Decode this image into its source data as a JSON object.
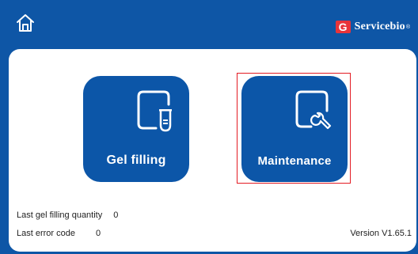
{
  "header": {
    "home_icon": "home-icon",
    "brand": {
      "mark": "G",
      "name": "Servicebio",
      "reg": "®",
      "mark_color": "#e8343a"
    }
  },
  "colors": {
    "background": "#0e56a6",
    "tile": "#0c56a8",
    "selection": "#e31b23"
  },
  "tiles": [
    {
      "label": "Gel filling",
      "icon": "gel-tube-icon"
    },
    {
      "label": "Maintenance",
      "icon": "wrench-icon"
    }
  ],
  "info": {
    "last_gel_filling_label": "Last gel filling quantity",
    "last_gel_filling_value": "0",
    "last_error_label": "Last error code",
    "last_error_value": "0",
    "version": "Version  V1.65.1"
  }
}
